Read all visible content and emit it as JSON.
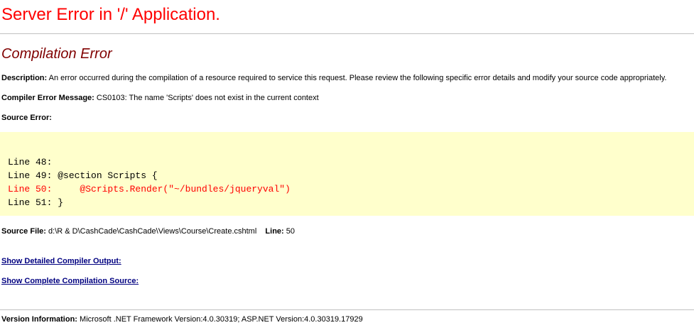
{
  "page": {
    "title": "Server Error in '/' Application.",
    "subtitle": "Compilation Error"
  },
  "description": {
    "label": "Description:",
    "text": "An error occurred during the compilation of a resource required to service this request. Please review the following specific error details and modify your source code appropriately."
  },
  "compiler_error": {
    "label": "Compiler Error Message:",
    "text": "CS0103: The name 'Scripts' does not exist in the current context"
  },
  "source_error": {
    "label": "Source Error:",
    "lines": [
      {
        "prefix": "Line 48:",
        "code": "",
        "is_error": false
      },
      {
        "prefix": "Line 49:",
        "code": "@section Scripts {",
        "is_error": false
      },
      {
        "prefix": "Line 50:",
        "code": "    @Scripts.Render(\"~/bundles/jqueryval\")",
        "is_error": true
      },
      {
        "prefix": "Line 51:",
        "code": "}",
        "is_error": false
      }
    ],
    "highlight_color": "#ffffcc",
    "error_color": "#ff0000"
  },
  "source_file": {
    "label": "Source File:",
    "path": "d:\\R & D\\CashCade\\CashCade\\Views\\Course\\Create.cshtml",
    "line_label": "Line:",
    "line_number": "50"
  },
  "links": {
    "detailed_output": "Show Detailed Compiler Output:",
    "complete_source": "Show Complete Compilation Source:"
  },
  "version": {
    "label": "Version Information:",
    "text": "Microsoft .NET Framework Version:4.0.30319; ASP.NET Version:4.0.30319.17929"
  }
}
